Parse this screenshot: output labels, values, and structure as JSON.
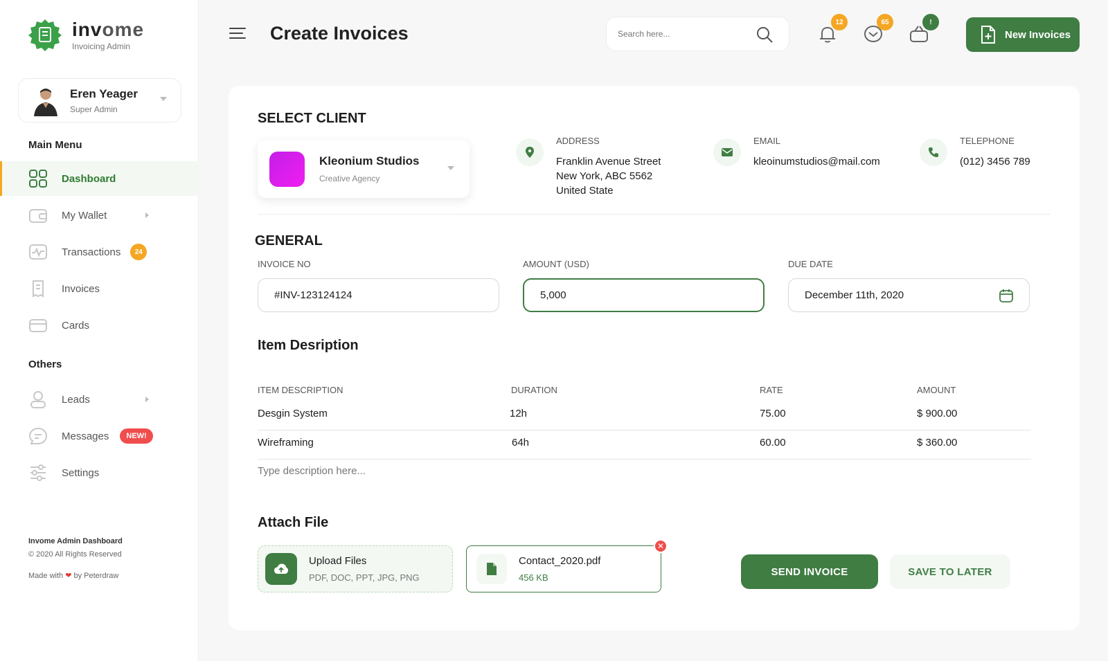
{
  "brand": {
    "name_part1": "inv",
    "name_part2": "ome",
    "subtitle": "Invoicing Admin",
    "accent_color": "#3f7d43"
  },
  "profile": {
    "name": "Eren Yeager",
    "role": "Super Admin"
  },
  "sidebar": {
    "main_menu_title": "Main Menu",
    "main_items": [
      {
        "label": "Dashboard",
        "icon": "dashboard-grid-icon",
        "active": true
      },
      {
        "label": "My Wallet",
        "icon": "wallet-icon",
        "has_submenu": true
      },
      {
        "label": "Transactions",
        "icon": "activity-icon",
        "badge": "24"
      },
      {
        "label": "Invoices",
        "icon": "receipt-icon"
      },
      {
        "label": "Cards",
        "icon": "card-icon"
      }
    ],
    "others_title": "Others",
    "other_items": [
      {
        "label": "Leads",
        "icon": "user-icon",
        "has_submenu": true
      },
      {
        "label": "Messages",
        "icon": "chat-icon",
        "badge": "NEW!"
      },
      {
        "label": "Settings",
        "icon": "sliders-icon"
      }
    ],
    "footer": {
      "title": "Invome Admin Dashboard",
      "copyright": "© 2020 All Rights Reserved",
      "made_with_prefix": "Made with",
      "made_with_suffix": "by Peterdraw"
    }
  },
  "header": {
    "page_title": "Create Invoices",
    "search_placeholder": "Search here...",
    "notifications_count": "12",
    "messages_count": "65",
    "cart_badge": "!",
    "new_button_label": "New Invoices"
  },
  "client": {
    "section_title": "SELECT CLIENT",
    "name": "Kleonium Studios",
    "type": "Creative Agency",
    "swatch_color": "#d61ef0",
    "address_label": "ADDRESS",
    "address_lines": [
      "Franklin Avenue Street",
      "New York, ABC 5562",
      "United State"
    ],
    "email_label": "EMAIL",
    "email": "kleoinumstudios@mail.com",
    "telephone_label": "TELEPHONE",
    "telephone": "(012) 3456 789"
  },
  "general": {
    "section_title": "GENERAL",
    "invoice_no_label": "INVOICE NO",
    "invoice_no": "#INV-123124124",
    "amount_label": "AMOUNT (USD)",
    "amount": "5,000",
    "due_date_label": "DUE DATE",
    "due_date": "December 11th, 2020"
  },
  "items": {
    "section_title": "Item Desription",
    "headers": [
      "ITEM DESCRIPTION",
      "DURATION",
      "RATE",
      "AMOUNT"
    ],
    "rows": [
      [
        "Desgin System",
        "12h",
        "75.00",
        "$ 900.00"
      ],
      [
        "Wireframing",
        "64h",
        "60.00",
        "$ 360.00"
      ]
    ],
    "description_placeholder": "Type description here..."
  },
  "attach": {
    "section_title": "Attach File",
    "upload_title": "Upload Files",
    "upload_types": "PDF, DOC, PPT, JPG, PNG",
    "file_name": "Contact_2020.pdf",
    "file_size": "456 KB"
  },
  "actions": {
    "send_label": "SEND INVOICE",
    "save_label": "SAVE TO LATER"
  }
}
